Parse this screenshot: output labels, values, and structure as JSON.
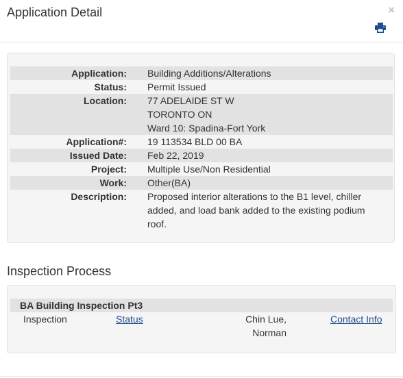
{
  "modal": {
    "title": "Application Detail",
    "close_label": "×",
    "print_icon": "printer-icon"
  },
  "details": [
    {
      "label": "Application:",
      "value": "Building Additions/Alterations"
    },
    {
      "label": "Status:",
      "value": "Permit Issued"
    },
    {
      "label": "Location:",
      "lines": [
        "77 ADELAIDE ST W",
        "TORONTO ON",
        "Ward 10: Spadina-Fort York"
      ]
    },
    {
      "label": "Application#:",
      "value": "19 113534 BLD 00 BA"
    },
    {
      "label": "Issued Date:",
      "value": "Feb 22, 2019"
    },
    {
      "label": "Project:",
      "value": "Multiple Use/Non Residential"
    },
    {
      "label": "Work:",
      "value": "Other(BA)"
    },
    {
      "label": "Description:",
      "lines": [
        "Proposed interior alterations to the B1 level, chiller",
        "added, and load bank added to the existing podium",
        "roof."
      ]
    }
  ],
  "inspection": {
    "section_title": "Inspection Process",
    "group_title": "BA Building Inspection Pt3",
    "row": {
      "type": "Inspection",
      "status_link": "Status",
      "inspector_lines": [
        "Chin Lue,",
        "Norman"
      ],
      "contact_link": "Contact Info"
    }
  },
  "colors": {
    "link": "#1f4e8c",
    "row_shade": "#e2e2e2",
    "well_bg": "#f5f5f5"
  }
}
